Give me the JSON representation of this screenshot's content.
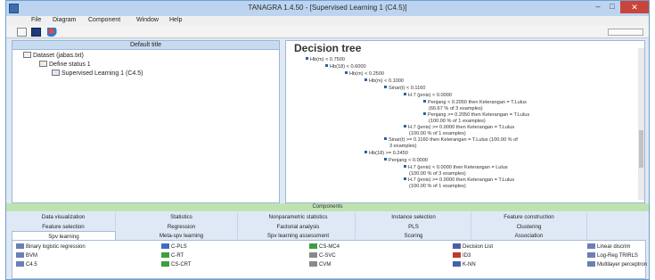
{
  "window": {
    "title": "TANAGRA 1.4.50 - [Supervised Learning 1 (C4.5)]"
  },
  "menu": [
    "File",
    "Diagram",
    "Component",
    "Window",
    "Help"
  ],
  "left": {
    "header": "Default title",
    "tree": [
      {
        "label": "Dataset (jabas.txt)",
        "depth": 0
      },
      {
        "label": "Define status 1",
        "depth": 1
      },
      {
        "label": "Supervised Learning 1 (C4.5)",
        "depth": 2
      }
    ]
  },
  "result": {
    "title": "Decision tree",
    "lines": [
      "Hb(m) < 0.7500",
      "Hb(18) < 0.6000",
      "Hb(m) < 0.2500",
      "Hb(m) < 0.1000",
      "Sinar(t) < 0.1160",
      "H.7 (jenis) < 0.0000",
      "Penjang < 0.2050 then Keterangan = T.Lulus",
      "(66.67 % of 3 examples)",
      "Penjang >= 0.2050 then Keterangan = T.Lulus",
      "(100.00 % of 1 examples)",
      "H.7 (jenis) >= 0.0000 then Keterangan = T.Lulus",
      "(100.00 % of 1 examples)",
      "Sinar(t) >= 0.1160 then Keterangan = T.Lulus (100.00 % of",
      "3 examples)",
      "Hb(18) >= 0.2450",
      "Penjang < 0.0000",
      "H.7 (jenis) < 0.0000 then Keterangan = Lulus",
      "(100.00 % of 3 examples)",
      "H.7 (jenis) >= 0.0000 then Keterangan = T.Lulus",
      "(100.00 % of 1 examples)"
    ]
  },
  "components": {
    "bar_label": "Components",
    "row1": [
      "Data visualization",
      "Statistics",
      "Nonparametric statistics",
      "Instance selection",
      "Feature construction"
    ],
    "row2": [
      "Feature selection",
      "Regression",
      "Factorial analysis",
      "PLS",
      "Clustering"
    ],
    "row3": [
      "Spv learning",
      "Meta-spv learning",
      "Spv learning assessment",
      "Scoring",
      "Association"
    ],
    "selected": "Spv learning",
    "list": [
      {
        "label": "Binary logistic regression",
        "color": "#6a7fb3"
      },
      {
        "label": "C-PLS",
        "color": "#3f6cc0"
      },
      {
        "label": "CS-MC4",
        "color": "#3e9e3e"
      },
      {
        "label": "Decision List",
        "color": "#4a5fa6"
      },
      {
        "label": "Linear discrim",
        "color": "#6a7fb3"
      },
      {
        "label": "BVM",
        "color": "#6a7fb3"
      },
      {
        "label": "C-RT",
        "color": "#3e9e3e"
      },
      {
        "label": "C-SVC",
        "color": "#8a8a8a"
      },
      {
        "label": "ID3",
        "color": "#c0392b"
      },
      {
        "label": "Log-Reg TRIRLS",
        "color": "#6a7fb3"
      },
      {
        "label": "C4.5",
        "color": "#6a7fb3"
      },
      {
        "label": "CS-CRT",
        "color": "#3e9e3e"
      },
      {
        "label": "CVM",
        "color": "#8a8a8a"
      },
      {
        "label": "K-NN",
        "color": "#4a5fa6"
      },
      {
        "label": "Multilayer perceptron",
        "color": "#6a7fb3"
      }
    ]
  }
}
